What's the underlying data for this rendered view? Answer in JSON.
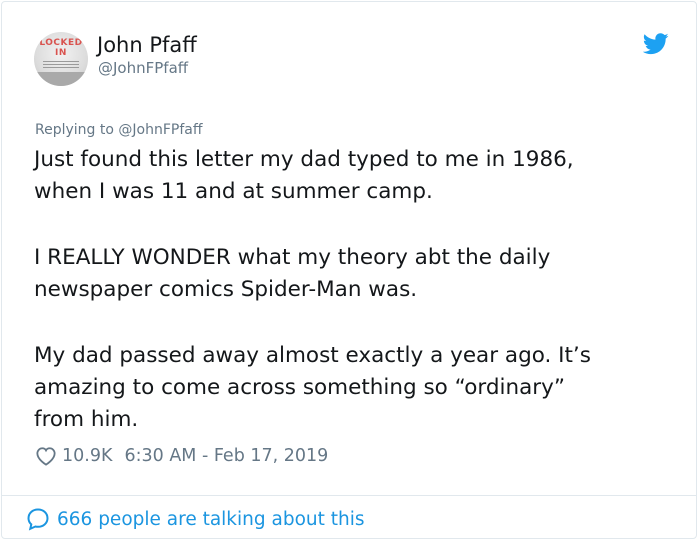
{
  "author": {
    "name": "John Pfaff",
    "handle": "@JohnFPfaff",
    "avatar_text": "LOCKED\nIN"
  },
  "reply": {
    "label": "Replying to @JohnFPfaff"
  },
  "tweet": {
    "paragraphs": [
      "Just found this letter my dad typed to me in 1986,\nwhen I was 11 and at summer camp.",
      "I REALLY WONDER what my theory abt the daily\nnewspaper comics Spider-Man was.",
      "My dad passed away almost exactly a year ago. It’s\namazing to come across something so “ordinary”\nfrom him."
    ]
  },
  "meta": {
    "likes": "10.9K",
    "timestamp": "6:30 AM - Feb 17, 2019"
  },
  "conversation": {
    "label": "666 people are talking about this"
  },
  "colors": {
    "twitter_blue": "#1da1f2",
    "link_blue": "#1b95e0",
    "secondary_text": "#657786",
    "primary_text": "#14171a"
  },
  "icons": [
    "twitter-bird-icon",
    "heart-icon",
    "comment-bubble-icon"
  ]
}
